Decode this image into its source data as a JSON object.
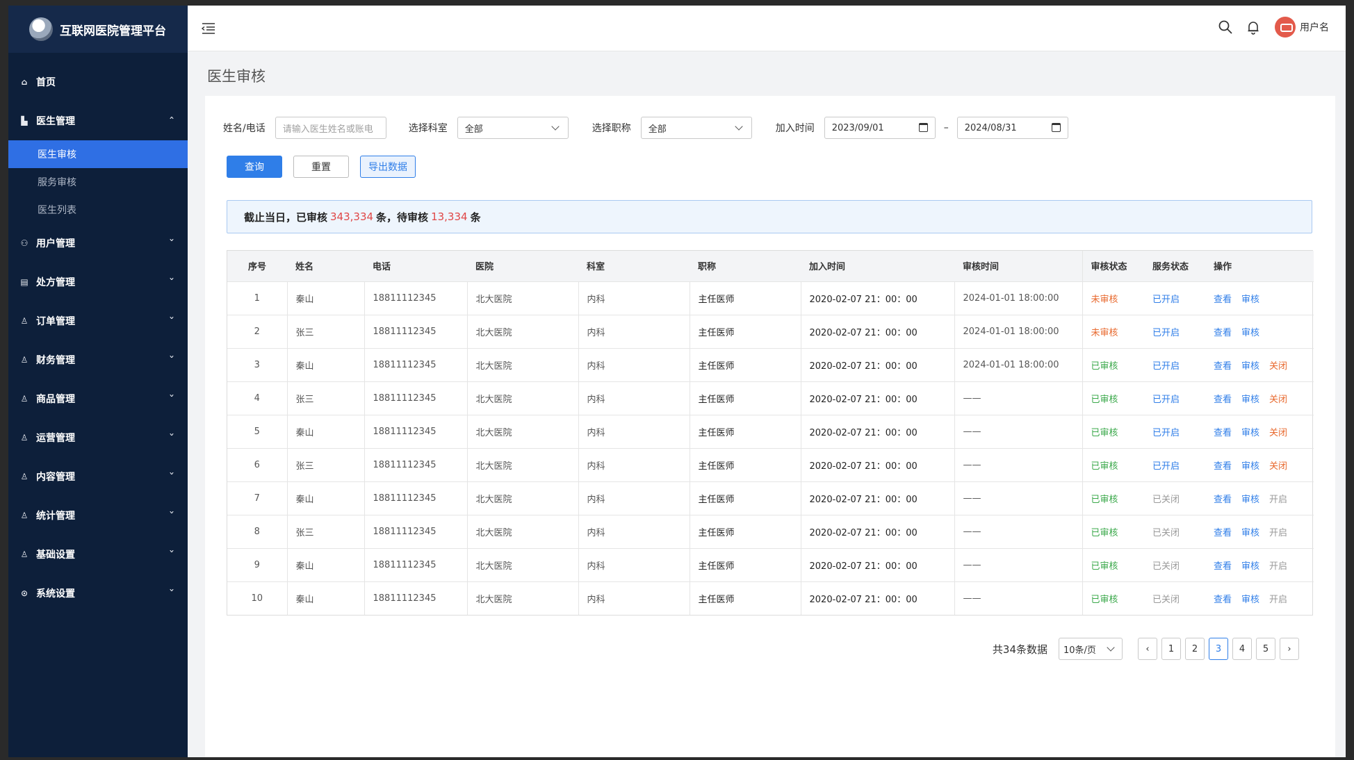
{
  "app": {
    "title": "互联网医院管理平台"
  },
  "sidebar": {
    "items": [
      {
        "label": "首页",
        "icon": "home-icon",
        "expandable": false
      },
      {
        "label": "医生管理",
        "icon": "hospital-icon",
        "expandable": true,
        "expanded": true,
        "children": [
          {
            "label": "医生审核",
            "active": true
          },
          {
            "label": "服务审核",
            "active": false
          },
          {
            "label": "医生列表",
            "active": false
          }
        ]
      },
      {
        "label": "用户管理",
        "icon": "org-icon",
        "expandable": true
      },
      {
        "label": "处方管理",
        "icon": "document-icon",
        "expandable": true
      },
      {
        "label": "订单管理",
        "icon": "user-icon",
        "expandable": true
      },
      {
        "label": "财务管理",
        "icon": "user-icon",
        "expandable": true
      },
      {
        "label": "商品管理",
        "icon": "user-icon",
        "expandable": true
      },
      {
        "label": "运营管理",
        "icon": "user-icon",
        "expandable": true
      },
      {
        "label": "内容管理",
        "icon": "user-icon",
        "expandable": true
      },
      {
        "label": "统计管理",
        "icon": "user-icon",
        "expandable": true
      },
      {
        "label": "基础设置",
        "icon": "user-icon",
        "expandable": true
      },
      {
        "label": "系统设置",
        "icon": "settings-icon",
        "expandable": true
      }
    ]
  },
  "header": {
    "username": "用户名"
  },
  "page": {
    "title": "医生审核"
  },
  "filters": {
    "name_label": "姓名/电话",
    "name_placeholder": "请输入医生姓名或账电",
    "dept_label": "选择科室",
    "dept_value": "全部",
    "title_label": "选择职称",
    "title_value": "全部",
    "date_label": "加入时间",
    "date_from": "2023/09/01",
    "date_sep": "–",
    "date_to": "2024/08/31"
  },
  "buttons": {
    "query": "查询",
    "reset": "重置",
    "export": "导出数据"
  },
  "notice": {
    "prefix": "截止当日，已审核",
    "reviewed": "343,334",
    "mid": "条，待审核",
    "pending": "13,334",
    "suffix": "条"
  },
  "table": {
    "headers": [
      "序号",
      "姓名",
      "电话",
      "医院",
      "科室",
      "职称",
      "加入时间",
      "审核时间",
      "审核状态",
      "服务状态",
      "操作"
    ],
    "rows": [
      {
        "no": "1",
        "name": "秦山",
        "phone": "18811112345",
        "hospital": "北大医院",
        "dept": "内科",
        "title": "主任医师",
        "joined": "2020-02-07 21：00：00",
        "reviewed": "2024-01-01 18:00:00",
        "audit": "未审核",
        "audit_kind": "pending",
        "service": "已开启",
        "service_kind": "open",
        "ops": [
          {
            "label": "查看",
            "kind": "blue"
          },
          {
            "label": "审核",
            "kind": "blue"
          }
        ]
      },
      {
        "no": "2",
        "name": "张三",
        "phone": "18811112345",
        "hospital": "北大医院",
        "dept": "内科",
        "title": "主任医师",
        "joined": "2020-02-07 21：00：00",
        "reviewed": "2024-01-01 18:00:00",
        "audit": "未审核",
        "audit_kind": "pending",
        "service": "已开启",
        "service_kind": "open",
        "ops": [
          {
            "label": "查看",
            "kind": "blue"
          },
          {
            "label": "审核",
            "kind": "blue"
          }
        ]
      },
      {
        "no": "3",
        "name": "秦山",
        "phone": "18811112345",
        "hospital": "北大医院",
        "dept": "内科",
        "title": "主任医师",
        "joined": "2020-02-07 21：00：00",
        "reviewed": "2024-01-01 18:00:00",
        "audit": "已审核",
        "audit_kind": "approved",
        "service": "已开启",
        "service_kind": "open",
        "ops": [
          {
            "label": "查看",
            "kind": "blue"
          },
          {
            "label": "审核",
            "kind": "blue"
          },
          {
            "label": "关闭",
            "kind": "red"
          }
        ]
      },
      {
        "no": "4",
        "name": "张三",
        "phone": "18811112345",
        "hospital": "北大医院",
        "dept": "内科",
        "title": "主任医师",
        "joined": "2020-02-07 21：00：00",
        "reviewed": "——",
        "audit": "已审核",
        "audit_kind": "approved",
        "service": "已开启",
        "service_kind": "open",
        "ops": [
          {
            "label": "查看",
            "kind": "blue"
          },
          {
            "label": "审核",
            "kind": "blue"
          },
          {
            "label": "关闭",
            "kind": "red"
          }
        ]
      },
      {
        "no": "5",
        "name": "秦山",
        "phone": "18811112345",
        "hospital": "北大医院",
        "dept": "内科",
        "title": "主任医师",
        "joined": "2020-02-07 21：00：00",
        "reviewed": "——",
        "audit": "已审核",
        "audit_kind": "approved",
        "service": "已开启",
        "service_kind": "open",
        "ops": [
          {
            "label": "查看",
            "kind": "blue"
          },
          {
            "label": "审核",
            "kind": "blue"
          },
          {
            "label": "关闭",
            "kind": "red"
          }
        ]
      },
      {
        "no": "6",
        "name": "张三",
        "phone": "18811112345",
        "hospital": "北大医院",
        "dept": "内科",
        "title": "主任医师",
        "joined": "2020-02-07 21：00：00",
        "reviewed": "——",
        "audit": "已审核",
        "audit_kind": "approved",
        "service": "已开启",
        "service_kind": "open",
        "ops": [
          {
            "label": "查看",
            "kind": "blue"
          },
          {
            "label": "审核",
            "kind": "blue"
          },
          {
            "label": "关闭",
            "kind": "red"
          }
        ]
      },
      {
        "no": "7",
        "name": "秦山",
        "phone": "18811112345",
        "hospital": "北大医院",
        "dept": "内科",
        "title": "主任医师",
        "joined": "2020-02-07 21：00：00",
        "reviewed": "——",
        "audit": "已审核",
        "audit_kind": "approved",
        "service": "已关闭",
        "service_kind": "closed",
        "ops": [
          {
            "label": "查看",
            "kind": "blue"
          },
          {
            "label": "审核",
            "kind": "blue"
          },
          {
            "label": "开启",
            "kind": "gray"
          }
        ]
      },
      {
        "no": "8",
        "name": "张三",
        "phone": "18811112345",
        "hospital": "北大医院",
        "dept": "内科",
        "title": "主任医师",
        "joined": "2020-02-07 21：00：00",
        "reviewed": "——",
        "audit": "已审核",
        "audit_kind": "approved",
        "service": "已关闭",
        "service_kind": "closed",
        "ops": [
          {
            "label": "查看",
            "kind": "blue"
          },
          {
            "label": "审核",
            "kind": "blue"
          },
          {
            "label": "开启",
            "kind": "gray"
          }
        ]
      },
      {
        "no": "9",
        "name": "秦山",
        "phone": "18811112345",
        "hospital": "北大医院",
        "dept": "内科",
        "title": "主任医师",
        "joined": "2020-02-07 21：00：00",
        "reviewed": "——",
        "audit": "已审核",
        "audit_kind": "approved",
        "service": "已关闭",
        "service_kind": "closed",
        "ops": [
          {
            "label": "查看",
            "kind": "blue"
          },
          {
            "label": "审核",
            "kind": "blue"
          },
          {
            "label": "开启",
            "kind": "gray"
          }
        ]
      },
      {
        "no": "10",
        "name": "秦山",
        "phone": "18811112345",
        "hospital": "北大医院",
        "dept": "内科",
        "title": "主任医师",
        "joined": "2020-02-07 21：00：00",
        "reviewed": "——",
        "audit": "已审核",
        "audit_kind": "approved",
        "service": "已关闭",
        "service_kind": "closed",
        "ops": [
          {
            "label": "查看",
            "kind": "blue"
          },
          {
            "label": "审核",
            "kind": "blue"
          },
          {
            "label": "开启",
            "kind": "gray"
          }
        ]
      }
    ]
  },
  "pagination": {
    "total": "共34条数据",
    "page_size": "10条/页",
    "pages": [
      "1",
      "2",
      "3",
      "4",
      "5"
    ],
    "current": "3"
  },
  "colors": {
    "primary": "#2f7ee8",
    "sidebar": "#0d1f3a",
    "pending": "#e8692e",
    "approved": "#3aa84a",
    "danger": "#e04646"
  }
}
